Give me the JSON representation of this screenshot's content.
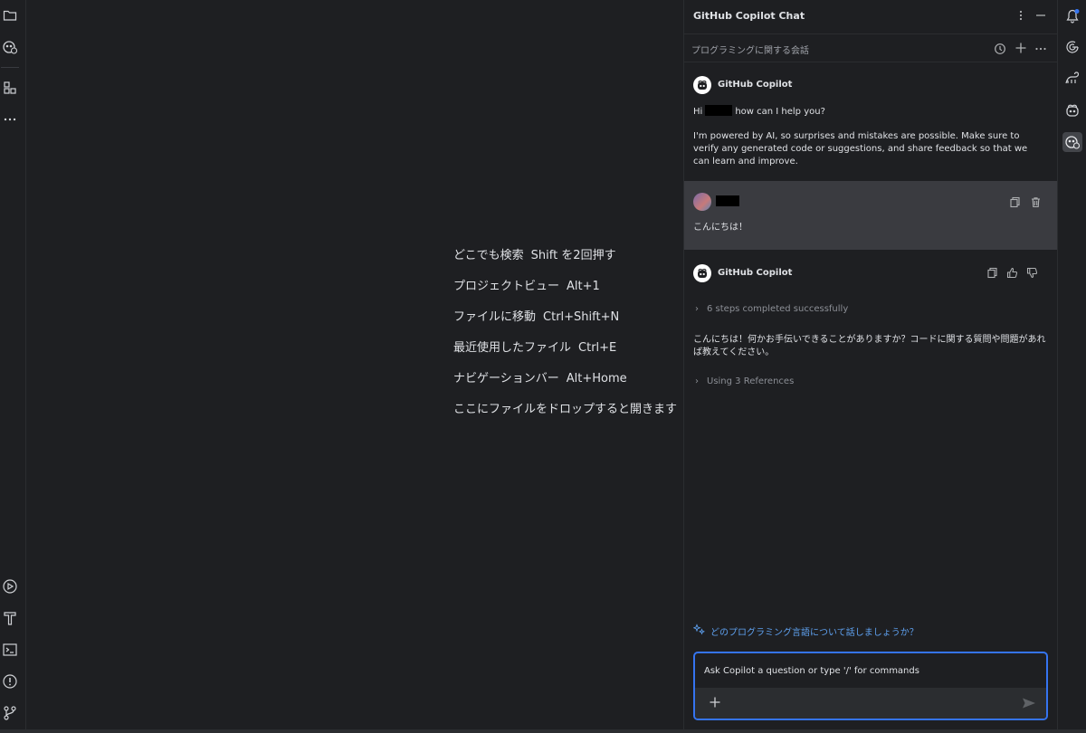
{
  "editor": {
    "hints": [
      {
        "label": "どこでも検索",
        "key": "Shift を2回押す"
      },
      {
        "label": "プロジェクトビュー",
        "key": "Alt+1"
      },
      {
        "label": "ファイルに移動",
        "key": "Ctrl+Shift+N"
      },
      {
        "label": "最近使用したファイル",
        "key": "Ctrl+E"
      },
      {
        "label": "ナビゲーションバー",
        "key": "Alt+Home"
      },
      {
        "label": "ここにファイルをドロップすると開きます",
        "key": ""
      }
    ]
  },
  "left_toolbar": {
    "top_icons": [
      "folder-icon",
      "copilot-icon",
      "structure-icon",
      "more-icon"
    ],
    "bottom_icons": [
      "services-icon",
      "build-icon",
      "terminal-icon",
      "problems-icon",
      "git-icon"
    ]
  },
  "chat": {
    "title": "GitHub Copilot Chat",
    "conversation_title": "プログラミングに関する会話",
    "messages": [
      {
        "author": "GitHub Copilot",
        "greeting_prefix": "Hi",
        "greeting_suffix": "how can I help you?",
        "body": "I'm powered by AI, so surprises and mistakes are possible. Make sure to verify any generated code or suggestions, and share feedback so that we can learn and improve."
      },
      {
        "author": "",
        "body": "こんにちは！"
      },
      {
        "author": "GitHub Copilot",
        "steps": "6 steps completed successfully",
        "body": "こんにちは！何かお手伝いできることがありますか？コードに関する質問や問題があれば教えてください。",
        "references": "Using 3 References"
      }
    ],
    "suggestion": "どのプログラミング言語について話しましょうか？",
    "input": {
      "placeholder": "Ask Copilot a question or type '/' for commands",
      "value": ""
    }
  },
  "right_toolbar": {
    "icons": [
      "notifications-icon",
      "ai-assistant-icon",
      "gradle-icon",
      "copilot-icon",
      "copilot-chat-icon"
    ]
  },
  "colors": {
    "background": "#1e1f22",
    "user_message_bg": "#3a3b40",
    "accent": "#3574f0",
    "link": "#5ea0ef"
  }
}
